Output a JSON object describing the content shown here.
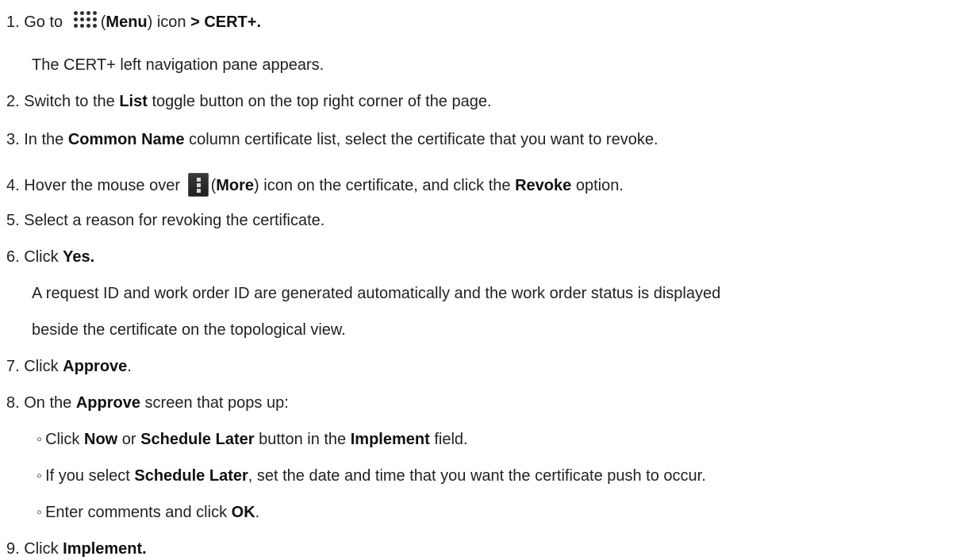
{
  "steps": {
    "s1": {
      "num": "1.",
      "pre": "Go to",
      "paren_open": "(",
      "menu": "Menu",
      "post": ") icon",
      "arrow": "> CERT+."
    },
    "s1_note": "The CERT+ left navigation pane appears.",
    "s2": {
      "num": "2.",
      "pre": "Switch to the",
      "list": "List",
      "post": "toggle button on the top right corner of the page."
    },
    "s3": {
      "num": "3.",
      "pre": "In the",
      "common": "Common Name",
      "post": "column certificate list, select the certificate that you want to revoke."
    },
    "s4": {
      "num": "4.",
      "pre": "Hover the mouse over",
      "paren_open": "(",
      "more": "More",
      "mid": ") icon on the certificate, and click the",
      "revoke": "Revoke",
      "post": "option."
    },
    "s5": {
      "num": "5.",
      "text": "Select a reason for revoking the certificate."
    },
    "s6": {
      "num": "6.",
      "pre": "Click",
      "yes": "Yes."
    },
    "s6_note1": "A request ID and work order ID are generated automatically and the work order status is displayed",
    "s6_note2": "beside the certificate on the topological view.",
    "s7": {
      "num": "7.",
      "pre": "Click",
      "approve": "Approve",
      "post": "."
    },
    "s8": {
      "num": "8.",
      "pre": "On the",
      "approve": "Approve",
      "post": "screen that pops up:"
    },
    "s8a": {
      "bullet": "◦",
      "pre": "Click",
      "now": "Now",
      "or": "or",
      "later": "Schedule Later",
      "mid": "button in the",
      "implement": "Implement",
      "post": "field."
    },
    "s8b": {
      "bullet": "◦",
      "pre": "If you select",
      "later": "Schedule Later",
      "post": ", set the date and time that you want the certificate push to occur."
    },
    "s8c": {
      "bullet": "◦",
      "pre": "Enter comments and click",
      "ok": "OK",
      "post": "."
    },
    "s9": {
      "num": "9.",
      "pre": "Click",
      "implement": "Implement."
    }
  },
  "icons": {
    "menu": "grid-dots-icon",
    "more": "vertical-dots-icon"
  }
}
